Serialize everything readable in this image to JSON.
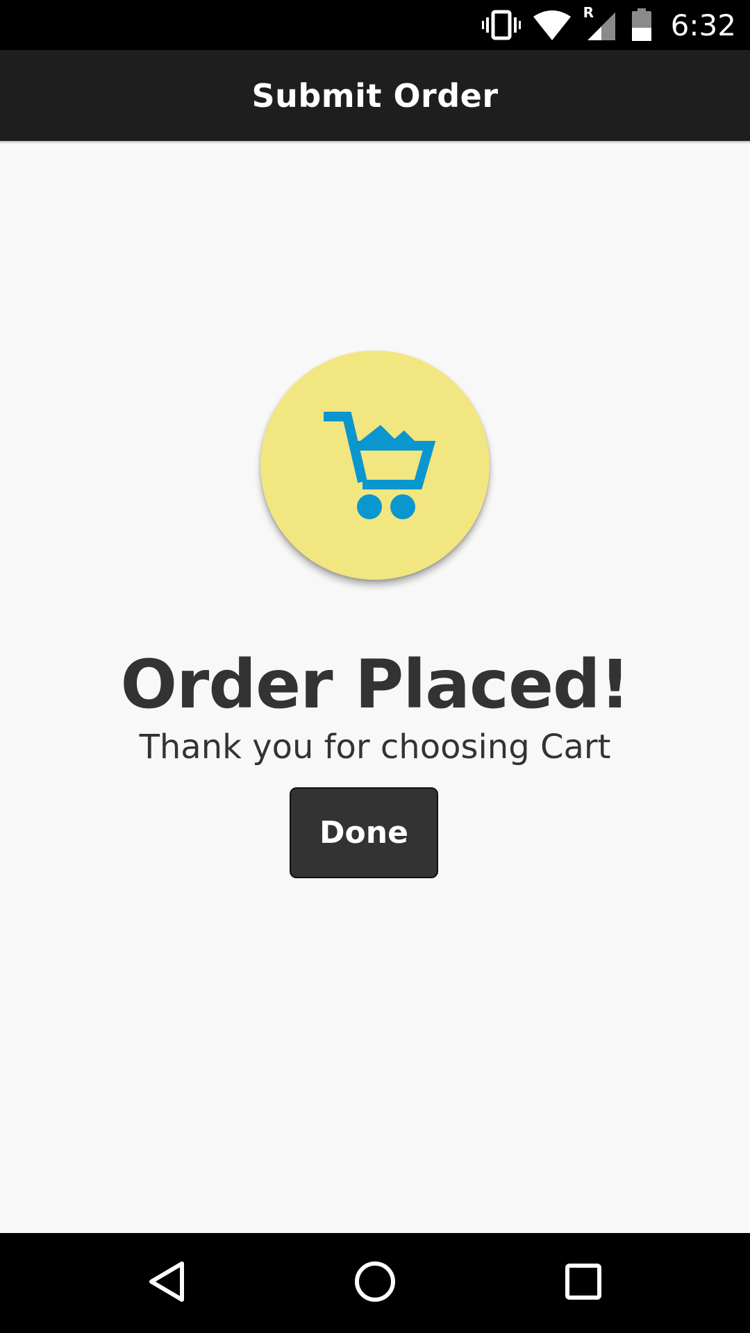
{
  "status_bar": {
    "time": "6:32",
    "icons": [
      "vibrate-icon",
      "wifi-icon",
      "roaming-icon",
      "cell-signal-icon",
      "battery-icon"
    ],
    "roaming_label": "R"
  },
  "app_bar": {
    "title": "Submit Order",
    "background": "#1e1e1e"
  },
  "confirmation": {
    "icon": "shopping-cart-icon",
    "badge_color": "#f2e680",
    "icon_color": "#0a97cf",
    "headline": "Order Placed!",
    "message": "Thank you for choosing Cart",
    "done_label": "Done"
  },
  "nav_bar": {
    "buttons": [
      "back-icon",
      "home-icon",
      "recents-icon"
    ]
  }
}
